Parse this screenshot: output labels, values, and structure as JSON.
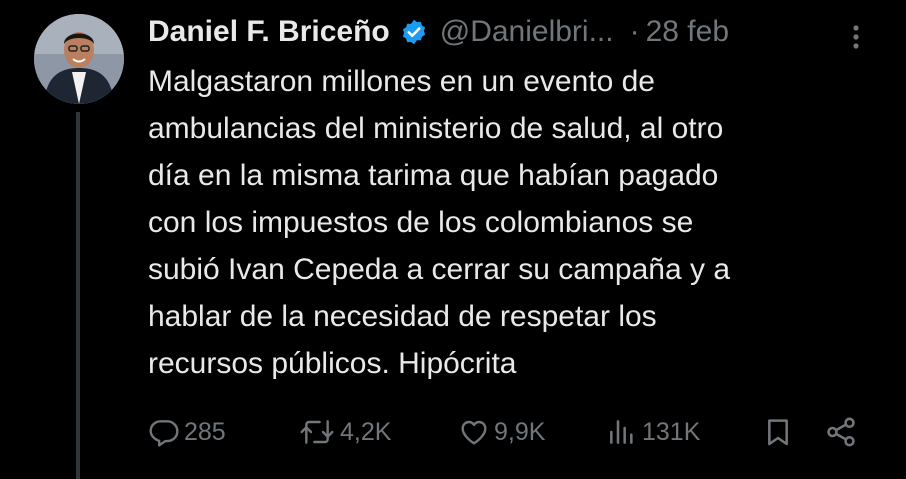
{
  "tweet": {
    "author_name": "Daniel F. Briceño",
    "handle": "@Danielbri...",
    "separator": "·",
    "date": "28 feb",
    "text_lines": [
      "Malgastaron millones en un evento de",
      "ambulancias del ministerio de salud, al otro",
      "día en la misma tarima que habían pagado",
      "con los impuestos de los colombianos se",
      "subió Ivan Cepeda a cerrar su campaña y a",
      "hablar de la necesidad de respetar los",
      "recursos públicos. Hipócrita"
    ]
  },
  "actions": {
    "replies": "285",
    "reposts": "4,2K",
    "likes": "9,9K",
    "views": "131K"
  },
  "icons": {
    "verified": "verified-badge-icon",
    "more": "more-vertical-icon",
    "reply": "reply-icon",
    "repost": "repost-icon",
    "like": "heart-icon",
    "views": "views-icon",
    "bookmark": "bookmark-icon",
    "share": "share-icon"
  },
  "colors": {
    "background": "#000000",
    "text": "#e7e9ea",
    "secondary": "#71767b",
    "verified": "#1d9bf0",
    "thread_line": "#333639"
  }
}
